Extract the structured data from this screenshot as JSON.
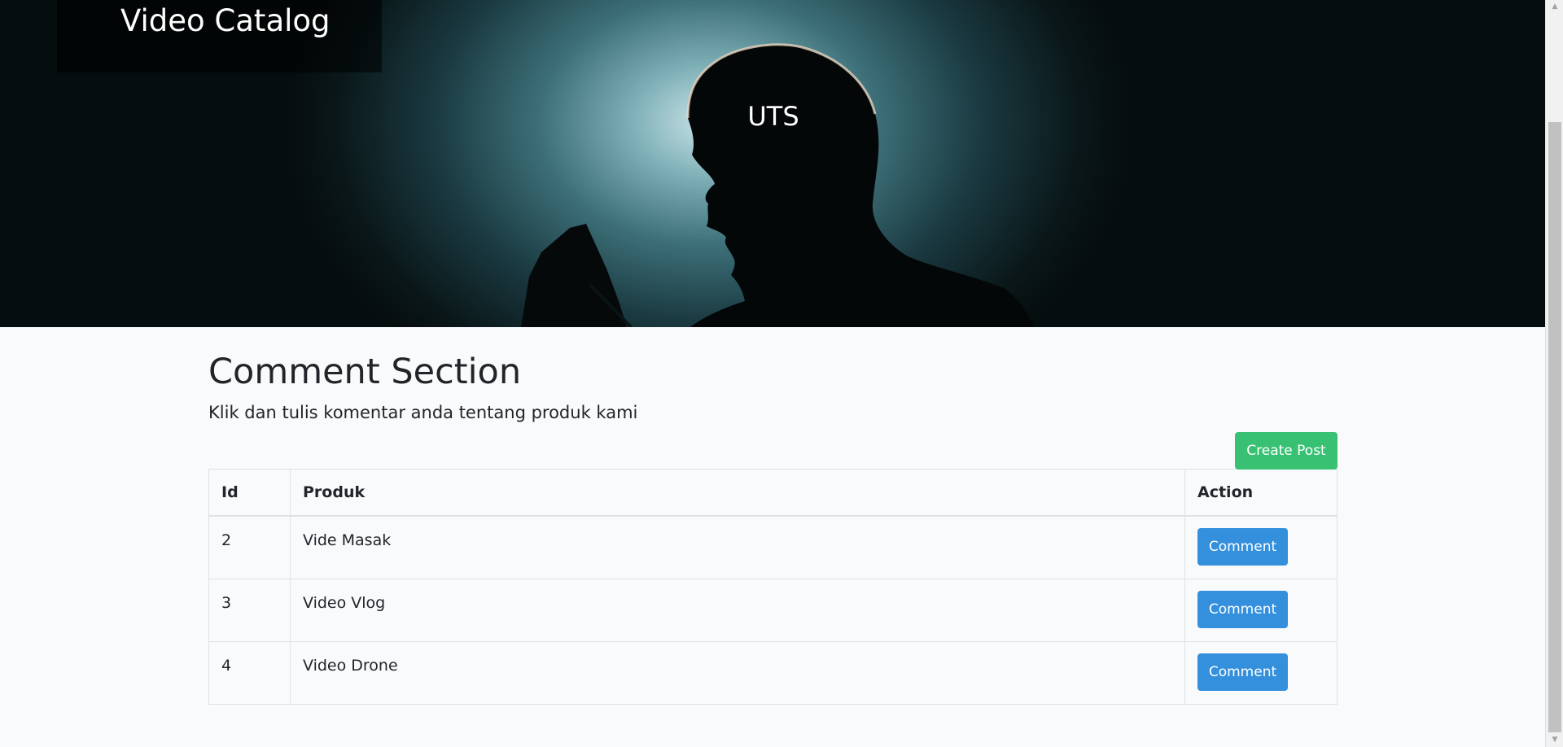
{
  "header": {
    "brand": "Video Catalog",
    "hero_heading": "UTS"
  },
  "main": {
    "title": "Comment Section",
    "subtitle": "Klik dan tulis komentar anda tentang produk kami",
    "create_button": "Create Post",
    "table": {
      "columns": [
        "Id",
        "Produk",
        "Action"
      ],
      "rows": [
        {
          "id": "2",
          "produk": "Vide Masak",
          "action": "Comment"
        },
        {
          "id": "3",
          "produk": "Video Vlog",
          "action": "Comment"
        },
        {
          "id": "4",
          "produk": "Video Drone",
          "action": "Comment"
        }
      ]
    }
  },
  "scrollbar": {
    "up_icon": "arrow-up-icon",
    "down_icon": "arrow-down-icon"
  },
  "colors": {
    "success": "#38c172",
    "primary": "#3490dc",
    "background": "#f8fafc"
  }
}
